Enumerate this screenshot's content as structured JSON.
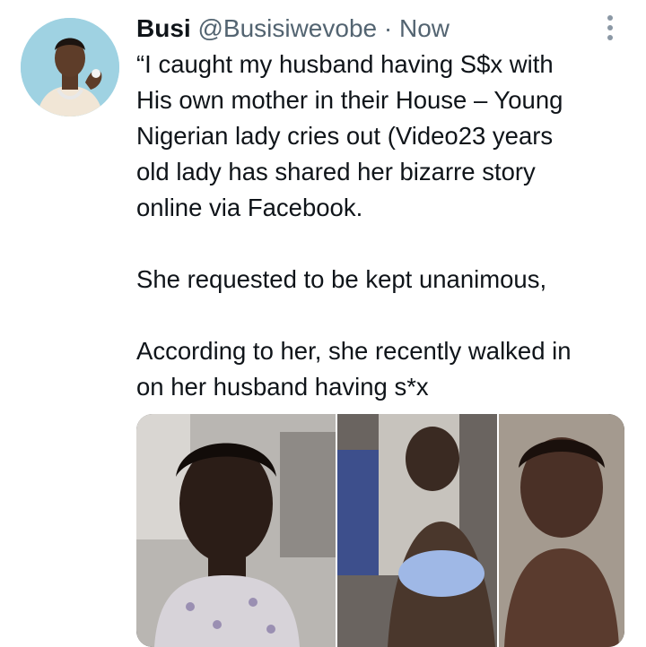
{
  "tweet": {
    "display_name": "Busi",
    "handle": "@Busisiwevobe",
    "separator": "·",
    "time": "Now",
    "lines": [
      "“I caught my husband having S$x with",
      "His own mother in their House – Young",
      "Nigerian lady cries out (Video23 years",
      "old lady has shared her bizarre story",
      "online via Facebook.",
      "",
      "She requested to be kept unanimous,",
      "",
      "According to her, she recently walked in",
      "on her husband having s*x"
    ]
  },
  "icons": {
    "more": "more-options-icon",
    "avatar": "avatar"
  },
  "colors": {
    "text": "#0f1419",
    "secondary": "#536471",
    "avatar_bg": "#9fd2e2"
  }
}
